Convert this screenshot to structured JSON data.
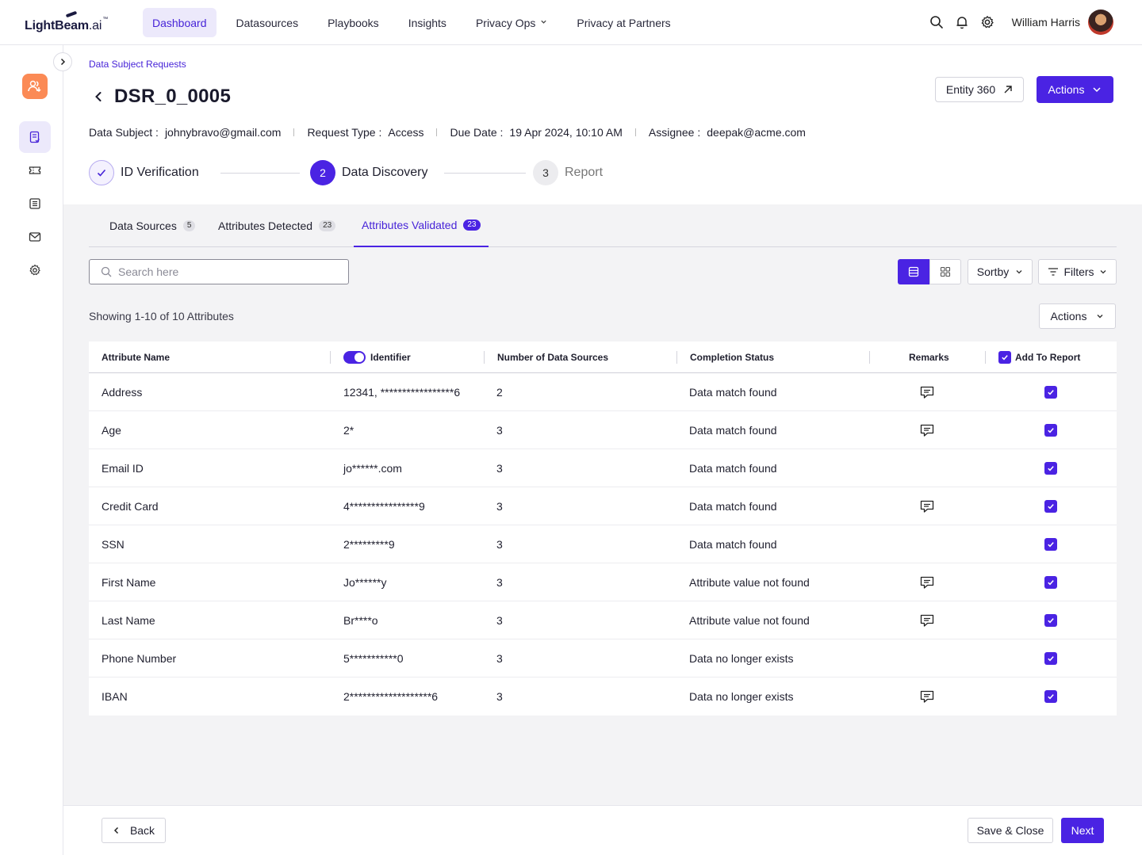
{
  "logo": {
    "brand": "LightBeam",
    "suffix": ".ai",
    "tm": "™"
  },
  "nav": {
    "items": [
      {
        "label": "Dashboard",
        "active": true
      },
      {
        "label": "Datasources"
      },
      {
        "label": "Playbooks"
      },
      {
        "label": "Insights"
      },
      {
        "label": "Privacy Ops",
        "dropdown": true
      },
      {
        "label": "Privacy at Partners"
      }
    ]
  },
  "user": {
    "name": "William Harris"
  },
  "sidebar": {
    "icons": [
      "dsr-icon",
      "ticket-icon",
      "list-icon",
      "mail-icon",
      "gear-icon"
    ]
  },
  "breadcrumb": "Data Subject Requests",
  "page": {
    "title": "DSR_0_0005",
    "entity_button": "Entity 360",
    "actions_button": "Actions"
  },
  "meta": [
    {
      "label": "Data Subject :",
      "value": "johnybravo@gmail.com"
    },
    {
      "label": "Request Type :",
      "value": "Access"
    },
    {
      "label": "Due Date :",
      "value": "19 Apr 2024, 10:10 AM"
    },
    {
      "label": "Assignee :",
      "value": "deepak@acme.com"
    }
  ],
  "steps": [
    {
      "number": "",
      "label": "ID Verification",
      "state": "done"
    },
    {
      "number": "2",
      "label": "Data Discovery",
      "state": "current"
    },
    {
      "number": "3",
      "label": "Report",
      "state": "pending"
    }
  ],
  "tabs": [
    {
      "label": "Data Sources",
      "count": "5"
    },
    {
      "label": "Attributes Detected",
      "count": "23"
    },
    {
      "label": "Attributes Validated",
      "count": "23",
      "active": true
    }
  ],
  "search": {
    "placeholder": "Search here"
  },
  "toolbar": {
    "sort_label": "Sortby",
    "filter_label": "Filters",
    "actions_label": "Actions"
  },
  "showing": "Showing 1-10 of 10 Attributes",
  "table": {
    "headers": {
      "attribute": "Attribute Name",
      "identifier": "Identifier",
      "sources": "Number of Data Sources",
      "status": "Completion Status",
      "remarks": "Remarks",
      "report": "Add To Report"
    },
    "rows": [
      {
        "name": "Address",
        "identifier": "12341, *****************6",
        "sources": "2",
        "status": "Data match found",
        "remark": true,
        "checked": true
      },
      {
        "name": "Age",
        "identifier": "2*",
        "sources": "3",
        "status": "Data match found",
        "remark": true,
        "checked": true
      },
      {
        "name": "Email ID",
        "identifier": "jo******.com",
        "sources": "3",
        "status": "Data match found",
        "remark": false,
        "checked": true
      },
      {
        "name": "Credit Card",
        "identifier": "4****************9",
        "sources": "3",
        "status": "Data match found",
        "remark": true,
        "checked": true
      },
      {
        "name": "SSN",
        "identifier": "2*********9",
        "sources": "3",
        "status": "Data match found",
        "remark": false,
        "checked": true
      },
      {
        "name": "First Name",
        "identifier": "Jo******y",
        "sources": "3",
        "status": "Attribute value not found",
        "remark": true,
        "checked": true
      },
      {
        "name": "Last Name",
        "identifier": "Br****o",
        "sources": "3",
        "status": "Attribute value not found",
        "remark": true,
        "checked": true
      },
      {
        "name": "Phone Number",
        "identifier": "5***********0",
        "sources": "3",
        "status": "Data no longer exists",
        "remark": false,
        "checked": true
      },
      {
        "name": "IBAN",
        "identifier": "2*******************6",
        "sources": "3",
        "status": "Data no longer exists",
        "remark": true,
        "checked": true
      }
    ]
  },
  "footer": {
    "back_label": "Back",
    "save_label": "Save & Close",
    "next_label": "Next"
  },
  "colors": {
    "accent": "#4a23e3",
    "accent_light": "#ece9fb",
    "badge": "#fb8a55"
  }
}
